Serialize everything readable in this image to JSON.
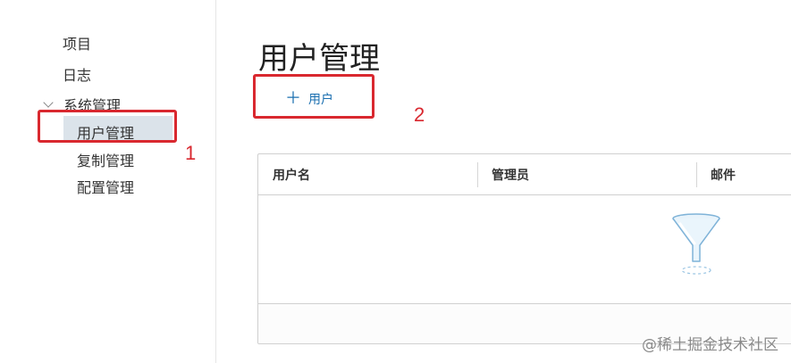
{
  "sidebar": {
    "items": [
      {
        "label": "项目"
      },
      {
        "label": "日志"
      }
    ],
    "group": {
      "label": "系统管理",
      "children": [
        {
          "label": "用户管理",
          "selected": true
        },
        {
          "label": "复制管理"
        },
        {
          "label": "配置管理"
        }
      ]
    }
  },
  "main": {
    "title": "用户管理",
    "add_button": {
      "icon": "plus-icon",
      "label": "用户"
    },
    "table": {
      "columns": [
        "用户名",
        "管理员",
        "邮件"
      ],
      "rows": [],
      "empty_icon": "funnel-icon"
    }
  },
  "annotations": {
    "labels": [
      "1",
      "2"
    ],
    "color": "#d9282f"
  },
  "watermark": "@稀土掘金技术社区",
  "colors": {
    "accent": "#1a6fb0",
    "selected_bg": "#dbe3ea"
  }
}
